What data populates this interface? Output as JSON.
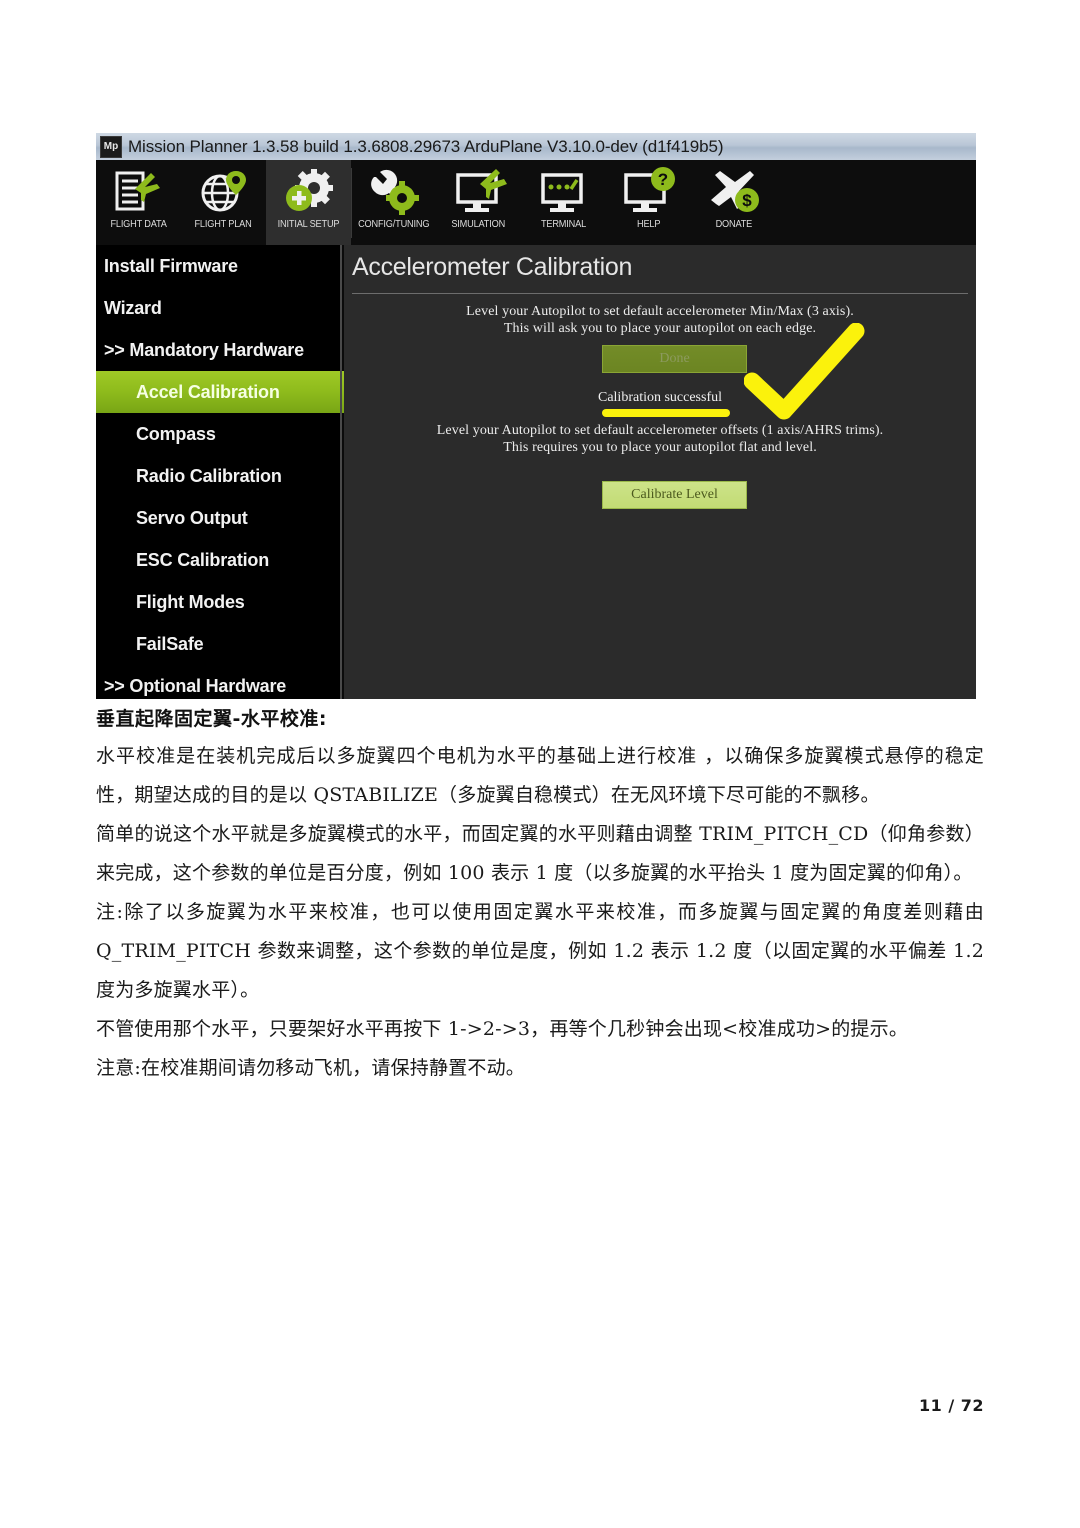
{
  "app": {
    "title": "Mission Planner 1.3.58 build 1.3.6808.29673 ArduPlane V3.10.0-dev (d1f419b5)",
    "logo_text": "Mp",
    "toolbar": [
      {
        "label": "FLIGHT DATA",
        "icon": "flight-data-icon",
        "active": false
      },
      {
        "label": "FLIGHT PLAN",
        "icon": "flight-plan-icon",
        "active": false
      },
      {
        "label": "INITIAL SETUP",
        "icon": "initial-setup-icon",
        "active": true
      },
      {
        "label": "CONFIG/TUNING",
        "icon": "config-tuning-icon",
        "active": false
      },
      {
        "label": "SIMULATION",
        "icon": "simulation-icon",
        "active": false
      },
      {
        "label": "TERMINAL",
        "icon": "terminal-icon",
        "active": false
      },
      {
        "label": "HELP",
        "icon": "help-icon",
        "active": false
      },
      {
        "label": "DONATE",
        "icon": "donate-icon",
        "active": false
      }
    ],
    "sidebar": [
      {
        "label": "Install Firmware",
        "level": 0,
        "selected": false
      },
      {
        "label": "Wizard",
        "level": 0,
        "selected": false
      },
      {
        "label": ">> Mandatory Hardware",
        "level": 0,
        "selected": false
      },
      {
        "label": "Accel Calibration",
        "level": 1,
        "selected": true
      },
      {
        "label": "Compass",
        "level": 1,
        "selected": false
      },
      {
        "label": "Radio Calibration",
        "level": 1,
        "selected": false
      },
      {
        "label": "Servo Output",
        "level": 1,
        "selected": false
      },
      {
        "label": "ESC Calibration",
        "level": 1,
        "selected": false
      },
      {
        "label": "Flight Modes",
        "level": 1,
        "selected": false
      },
      {
        "label": "FailSafe",
        "level": 1,
        "selected": false
      },
      {
        "label": ">> Optional Hardware",
        "level": 0,
        "selected": false
      }
    ],
    "panel": {
      "title": "Accelerometer Calibration",
      "instruction_1_line_1": "Level your Autopilot to set default accelerometer Min/Max (3 axis).",
      "instruction_1_line_2": "This will ask you to place your autopilot on each edge.",
      "done_button": "Done",
      "status": "Calibration successful",
      "instruction_2_line_1": "Level your Autopilot to set default accelerometer offsets (1 axis/AHRS trims).",
      "instruction_2_line_2": "This requires you to place your autopilot flat and level.",
      "calibrate_level_button": "Calibrate Level"
    },
    "colors": {
      "accent_green": "#8ebb1c",
      "highlight_yellow": "#fbf20c",
      "panel_bg": "#2b2b2b",
      "sidebar_bg": "#000000",
      "toolbar_bg": "#0d0d0d"
    }
  },
  "document": {
    "heading": "垂直起降固定翼-水平校准:",
    "paragraphs": [
      "水平校准是在装机完成后以多旋翼四个电机为水平的基础上进行校准 ，以确保多旋翼模式悬停的稳定性，期望达成的目的是以 QSTABILIZE（多旋翼自稳模式）在无风环境下尽可能的不飘移。",
      "简单的说这个水平就是多旋翼模式的水平，而固定翼的水平则藉由调整 TRIM_PITCH_CD（仰角参数）来完成，这个参数的单位是百分度，例如 100 表示 1 度（以多旋翼的水平抬头 1 度为固定翼的仰角）。",
      "注:除了以多旋翼为水平来校准，也可以使用固定翼水平来校准，而多旋翼与固定翼的角度差则藉由 Q_TRIM_PITCH 参数来调整，这个参数的单位是度，例如 1.2 表示 1.2 度（以固定翼的水平偏差 1.2 度为多旋翼水平）。",
      "不管使用那个水平，只要架好水平再按下 1->2->3，再等个几秒钟会出现<校准成功>的提示。",
      "注意:在校准期间请勿移动飞机，请保持静置不动。"
    ],
    "page_number": "11 / 72"
  }
}
